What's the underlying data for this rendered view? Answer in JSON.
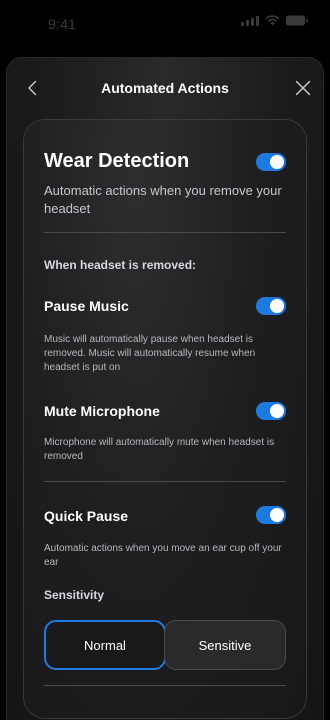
{
  "status_bar": {
    "time": "9:41",
    "signal_icon": "signal-bars-icon",
    "wifi_icon": "wifi-icon",
    "battery_icon": "battery-icon"
  },
  "nav": {
    "title": "Automated Actions",
    "back_icon": "chevron-left-icon",
    "close_icon": "close-icon"
  },
  "wear_detection": {
    "title": "Wear Detection",
    "description": "Automatic actions when you remove your headset",
    "enabled": true
  },
  "when_removed": {
    "label": "When headset is removed:"
  },
  "pause_music": {
    "title": "Pause Music",
    "description": "Music will automatically pause when headset is removed. Music will automatically resume when headset is put on",
    "enabled": true
  },
  "mute_microphone": {
    "title": "Mute Microphone",
    "description": "Microphone will automatically mute when headset is removed",
    "enabled": true
  },
  "quick_pause": {
    "title": "Quick Pause",
    "description": "Automatic actions when you move an ear cup off your ear",
    "enabled": true
  },
  "sensitivity": {
    "label": "Sensitivity",
    "options": [
      "Normal",
      "Sensitive"
    ],
    "selected": "Normal"
  },
  "colors": {
    "accent": "#1f7ae0",
    "background": "#000000",
    "card": "#1e1e20"
  }
}
